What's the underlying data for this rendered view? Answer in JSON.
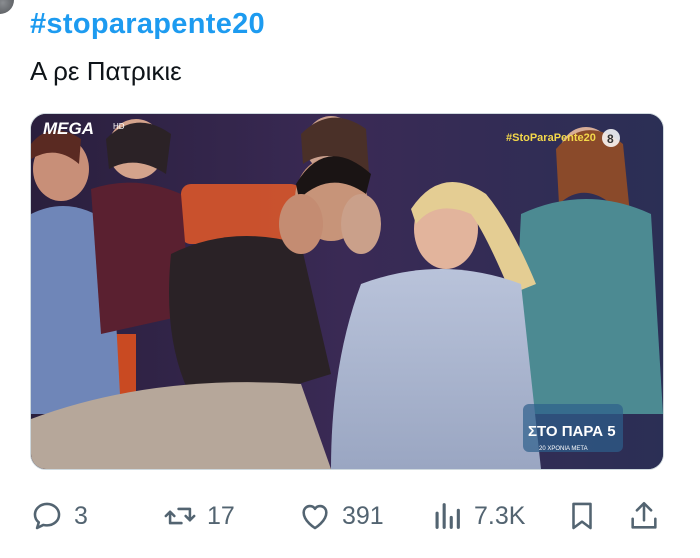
{
  "tweet": {
    "hashtag": "#stoparapente20",
    "text": "Α ρε Πατρικιε"
  },
  "media": {
    "channel_logo": "MEGA",
    "channel_logo_suffix": "HD",
    "broadcast_hashtag": "#StoParaPente20",
    "age_rating": "8",
    "show_logo": "ΣΤΟ ΠΑΡΑ 5",
    "show_logo_sub": "20 ΧΡΟΝΙΑ ΜΕΤΑ"
  },
  "actions": {
    "reply_count": "3",
    "retweet_count": "17",
    "like_count": "391",
    "views_count": "7.3K"
  },
  "icons": {
    "reply": "reply-icon",
    "retweet": "retweet-icon",
    "like": "heart-icon",
    "views": "views-icon",
    "bookmark": "bookmark-icon",
    "share": "share-icon"
  },
  "colors": {
    "hashtag": "#1d9bf0",
    "action_gray": "#536471",
    "text": "#0f1419"
  }
}
